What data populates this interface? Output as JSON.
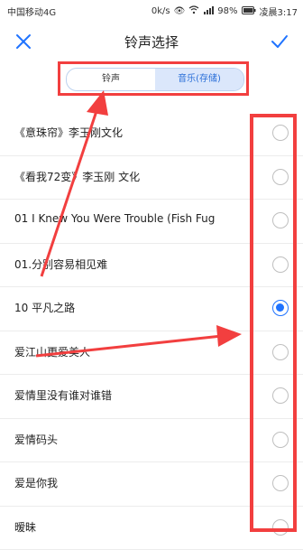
{
  "statusbar": {
    "carrier": "中国移动4G",
    "speed": "0k/s",
    "battery": "98%",
    "time": "凌晨3:17"
  },
  "header": {
    "title": "铃声选择"
  },
  "segments": {
    "ringtone_label": "铃声",
    "music_label": "音乐(存储)"
  },
  "list": {
    "items": [
      {
        "label": "《意珠帘》李玉刚文化",
        "selected": false
      },
      {
        "label": "《看我72变》李玉刚 文化",
        "selected": false
      },
      {
        "label": "01 I Knew You Were Trouble (Fish Fug",
        "selected": false
      },
      {
        "label": "01.分别容易相见难",
        "selected": false
      },
      {
        "label": "10 平凡之路",
        "selected": true
      },
      {
        "label": "爱江山更爱美人",
        "selected": false
      },
      {
        "label": "爱情里没有谁对谁错",
        "selected": false
      },
      {
        "label": "爱情码头",
        "selected": false
      },
      {
        "label": "爱是你我",
        "selected": false
      },
      {
        "label": "暧昧",
        "selected": false
      }
    ]
  },
  "colors": {
    "accent": "#1f73ff",
    "annotation": "#f23f3f"
  }
}
